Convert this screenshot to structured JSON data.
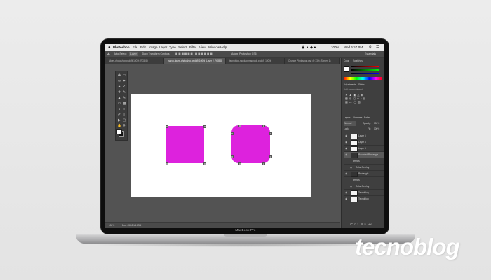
{
  "device": {
    "model_label": "MacBook Pro"
  },
  "watermark": {
    "text": "tecnoblog"
  },
  "menubar": {
    "app_name": "Photoshop",
    "items": [
      "File",
      "Edit",
      "Image",
      "Layer",
      "Type",
      "Select",
      "Filter",
      "View",
      "Window",
      "Help"
    ],
    "clock": "Wed 6:57 PM",
    "battery": "100%"
  },
  "options_bar": {
    "app_title": "Adobe Photoshop CS6",
    "auto_select_label": "Auto-Select:",
    "auto_select_value": "Layer",
    "show_transform_label": "Show Transform Controls",
    "workspace": "Essentials"
  },
  "document_tabs": [
    {
      "label": "slides-photoshop.psd @ 100% (RGB/8)",
      "active": false
    },
    {
      "label": "marco-figure-photoshop.psd @ 100% (Layer 2, RGB/8)",
      "active": true
    },
    {
      "label": "tecnoblog-mockup-macbook.psd @ 100%",
      "active": false
    },
    {
      "label": "Change Photoshop.psd @ 33% (Screen 1)",
      "active": false
    }
  ],
  "status_bar": {
    "zoom": "100%",
    "doc_info": "Doc: 658.8K/4.39M"
  },
  "panels": {
    "color_tabs": [
      "Color",
      "Swatches"
    ],
    "adjust_tabs": [
      "Adjustments",
      "Styles"
    ],
    "adjust_hint": "Add an adjustment",
    "layer_tabs": [
      "Layers",
      "Channels",
      "Paths"
    ],
    "blend_mode": "Normal",
    "opacity_label": "Opacity:",
    "opacity_value": "100%",
    "lock_label": "Lock:",
    "fill_label": "Fill:",
    "fill_value": "100%",
    "layers": [
      {
        "name": "Layer 5",
        "selected": false
      },
      {
        "name": "Layer 4",
        "selected": false
      },
      {
        "name": "Layer 3",
        "selected": false
      },
      {
        "name": "Rounded Rectangle",
        "selected": true
      },
      {
        "name": "Effects",
        "selected": false
      },
      {
        "name": "Color Overlay",
        "selected": false
      },
      {
        "name": "Rectangle",
        "selected": false
      },
      {
        "name": "Effects",
        "selected": false
      },
      {
        "name": "Color Overlay",
        "selected": false
      },
      {
        "name": "Tecnoblog",
        "selected": false
      },
      {
        "name": "Tecnoblog",
        "selected": false
      }
    ]
  },
  "colors": {
    "shape_fill": "#dd22dd",
    "canvas": "#ffffff",
    "ui_dark": "#535353"
  }
}
